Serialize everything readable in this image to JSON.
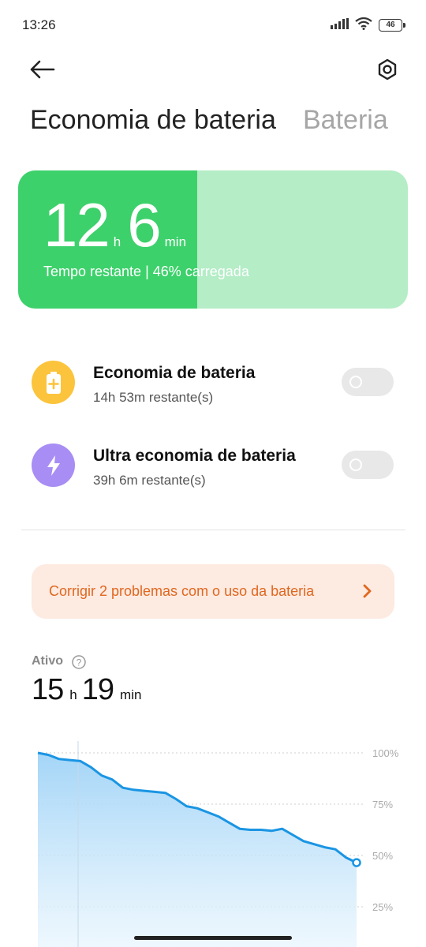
{
  "status_bar": {
    "time": "13:26",
    "battery_level": "46",
    "icons": [
      "signal-icon",
      "wifi-icon",
      "battery-icon"
    ]
  },
  "top_bar": {
    "back_icon": "arrow-left-icon",
    "settings_icon": "hexagon-settings-icon"
  },
  "tabs": {
    "active": "Economia de bateria",
    "inactive": "Bateria"
  },
  "battery_card": {
    "hours": "12",
    "hours_unit": "h",
    "minutes": "6",
    "minutes_unit": "min",
    "subtitle": "Tempo restante | 46% carregada",
    "charge_percent": 46,
    "colors": {
      "fill": "#3dd16b",
      "track": "#b4edc6"
    }
  },
  "modes": [
    {
      "title": "Economia de bateria",
      "subtitle": "14h 53m restante(s)",
      "icon": "battery-plus-icon",
      "icon_color": "#fcc43c",
      "enabled": false
    },
    {
      "title": "Ultra economia de bateria",
      "subtitle": "39h 6m restante(s)",
      "icon": "lightning-bolt-icon",
      "icon_color": "#a78df4",
      "enabled": false
    }
  ],
  "fix_banner": {
    "text": "Corrigir 2 problemas com o uso da bateria",
    "color": "#e0671f",
    "background": "#fdeae1"
  },
  "active_time": {
    "label": "Ativo",
    "hours": "15",
    "hours_unit": "h",
    "minutes": "19",
    "minutes_unit": "min"
  },
  "chart_data": {
    "type": "area",
    "y_ticks": [
      "100%",
      "75%",
      "50%",
      "25%"
    ],
    "ylim": [
      0,
      100
    ],
    "values": [
      100,
      99,
      97,
      96.5,
      96,
      93,
      89,
      87,
      83,
      82,
      81.5,
      81,
      80.5,
      77.5,
      74,
      73,
      71,
      69,
      66,
      63,
      62.5,
      62.5,
      62,
      63,
      60,
      57,
      55.5,
      54,
      53,
      49,
      46.5
    ],
    "color": "#1a95e3",
    "grid": true
  }
}
